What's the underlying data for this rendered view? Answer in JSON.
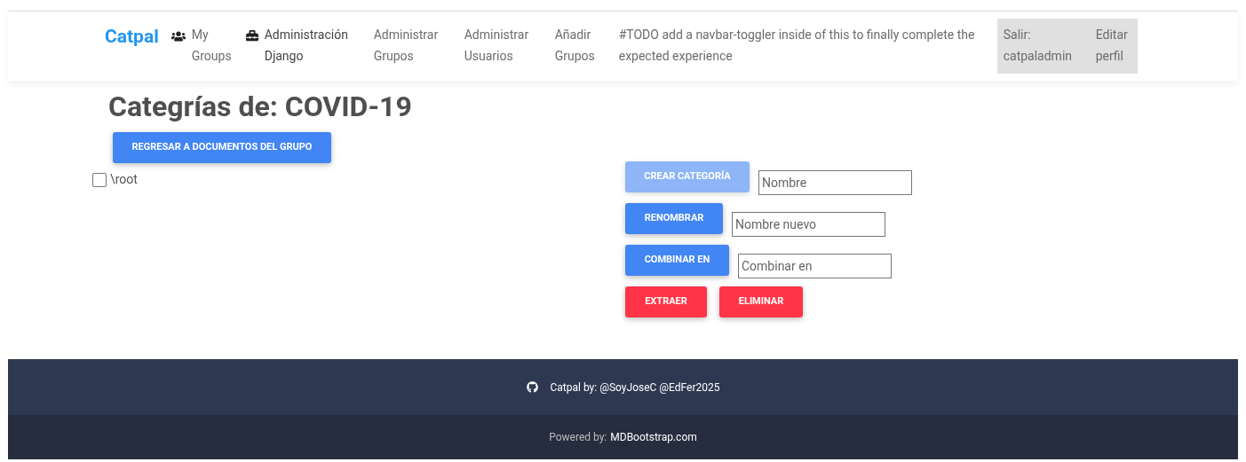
{
  "navbar": {
    "brand": "Catpal",
    "items": [
      {
        "label": "My Groups"
      },
      {
        "label": "Administración Django"
      },
      {
        "label": "Administrar Grupos"
      },
      {
        "label": "Administrar Usuarios"
      },
      {
        "label": "Añadir Grupos"
      }
    ],
    "note": "#TODO add a navbar-toggler inside of this to finally complete the expected experience",
    "user_items": [
      {
        "label": "Salir: catpaladmin"
      },
      {
        "label": "Editar perfil"
      }
    ]
  },
  "heading": "Categrías de: COVID-19",
  "back_button": "REGRESAR A DOCUMENTOS DEL GRUPO",
  "tree": [
    {
      "label": "\\root",
      "checked": false
    }
  ],
  "actions": [
    {
      "button": "CREAR CATEGORÍA",
      "disabled": true,
      "placeholder": "Nombre"
    },
    {
      "button": "RENOMBRAR",
      "disabled": false,
      "placeholder": "Nombre nuevo"
    },
    {
      "button": "COMBINAR EN",
      "disabled": false,
      "placeholder": "Combinar en"
    }
  ],
  "danger_buttons": [
    {
      "label": "EXTRAER"
    },
    {
      "label": "ELIMINAR"
    }
  ],
  "footer": {
    "credit": "Catpal by: @SoyJoseC @EdFer2025",
    "powered_label": "Powered by:",
    "powered_link": "MDBootstrap.com"
  }
}
